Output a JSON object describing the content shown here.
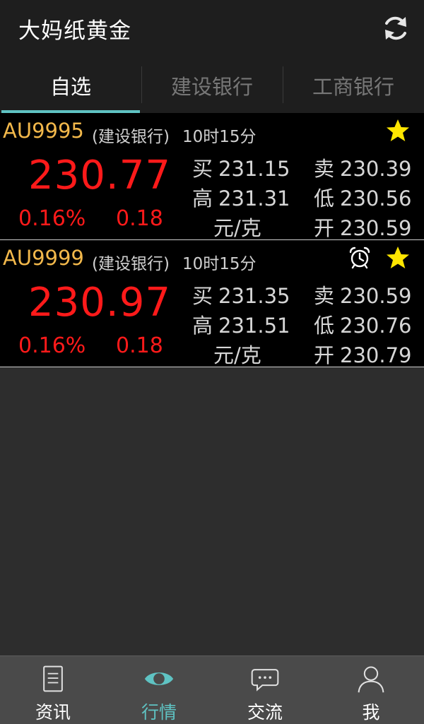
{
  "header": {
    "title": "大妈纸黄金",
    "refresh_icon": "refresh-icon"
  },
  "tabs": [
    {
      "label": "自选",
      "active": true
    },
    {
      "label": "建设银行",
      "active": false
    },
    {
      "label": "工商银行",
      "active": false
    }
  ],
  "quotes": [
    {
      "symbol": "AU9995",
      "bank": "(建设银行)",
      "time": "10时15分",
      "price": "230.77",
      "change_pct": "0.16%",
      "change": "0.18",
      "buy_label": "买",
      "buy": "231.15",
      "sell_label": "卖",
      "sell": "230.39",
      "high_label": "高",
      "high": "231.31",
      "low_label": "低",
      "low": "230.56",
      "unit": "元/克",
      "open_label": "开",
      "open": "230.59",
      "has_alarm": false,
      "starred": true
    },
    {
      "symbol": "AU9999",
      "bank": "(建设银行)",
      "time": "10时15分",
      "price": "230.97",
      "change_pct": "0.16%",
      "change": "0.18",
      "buy_label": "买",
      "buy": "231.35",
      "sell_label": "卖",
      "sell": "230.59",
      "high_label": "高",
      "high": "231.51",
      "low_label": "低",
      "low": "230.76",
      "unit": "元/克",
      "open_label": "开",
      "open": "230.79",
      "has_alarm": true,
      "starred": true
    }
  ],
  "bottom_nav": [
    {
      "label": "资讯",
      "icon": "document-icon",
      "active": false
    },
    {
      "label": "行情",
      "icon": "eye-icon",
      "active": true
    },
    {
      "label": "交流",
      "icon": "chat-bubble-icon",
      "active": false
    },
    {
      "label": "我",
      "icon": "user-icon",
      "active": false
    }
  ],
  "colors": {
    "accent": "#5fc3c3",
    "price_up": "#ff1a1a",
    "symbol": "#f2b84b",
    "star": "#ffe600"
  }
}
